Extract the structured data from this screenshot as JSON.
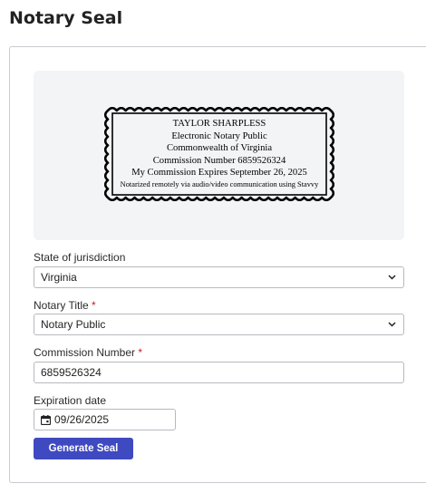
{
  "page_title": "Notary Seal",
  "seal": {
    "lines": [
      "TAYLOR SHARPLESS",
      "Electronic Notary Public",
      "Commonwealth of Virginia",
      "Commission Number 6859526324",
      "My Commission Expires September 26, 2025",
      "Notarized remotely via audio/video communication using Stavvy"
    ]
  },
  "form": {
    "state_label": "State of jurisdiction",
    "state_value": "Virginia",
    "title_label": "Notary Title",
    "title_value": "Notary Public",
    "commission_label": "Commission Number",
    "commission_value": "6859526324",
    "expiration_label": "Expiration date",
    "expiration_value": "09/26/2025",
    "required_mark": "*",
    "submit_label": "Generate Seal"
  },
  "colors": {
    "accent": "#3f4ac1",
    "required": "#c0202a",
    "preview_bg": "#f3f4f6"
  },
  "icons": {
    "dropdown": "chevron-down-icon",
    "date": "calendar-icon"
  }
}
